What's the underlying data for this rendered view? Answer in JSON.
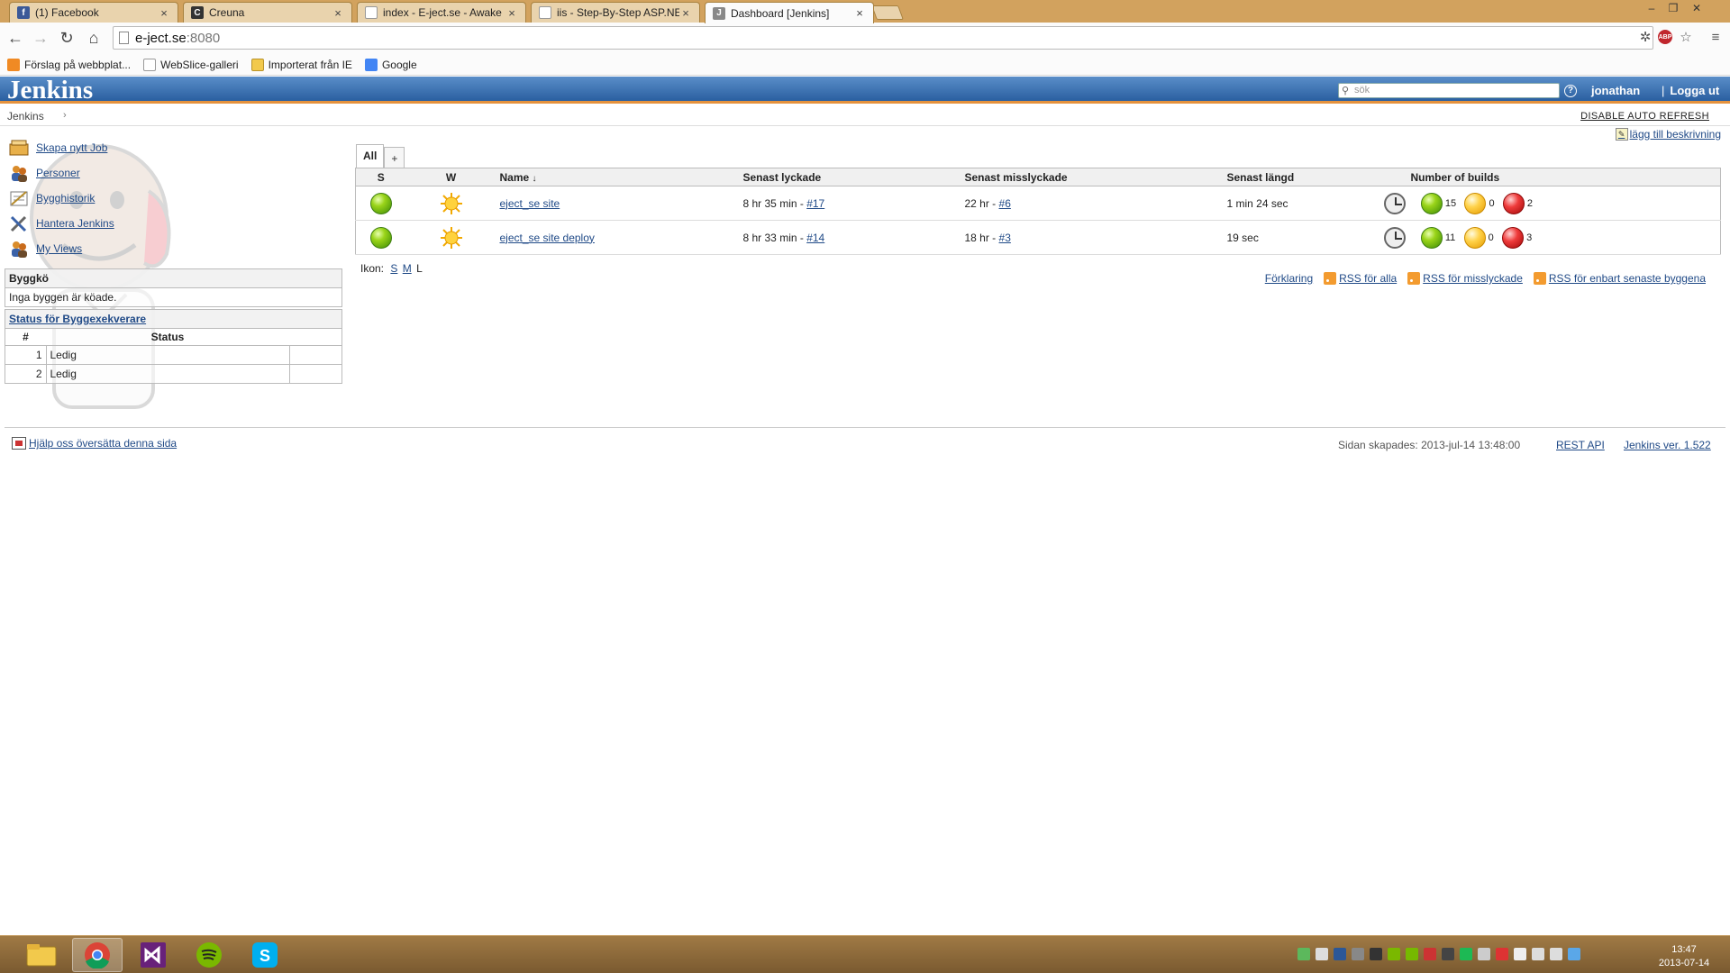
{
  "browser": {
    "tabs": [
      {
        "title": "(1) Facebook",
        "favicon_color": "#3b5998",
        "favicon_glyph": "f"
      },
      {
        "title": "Creuna",
        "favicon_color": "#333333",
        "favicon_glyph": "C"
      },
      {
        "title": "index - E-ject.se - Awake ...",
        "favicon_color": "#dddddd",
        "favicon_glyph": ""
      },
      {
        "title": "iis - Step-By-Step ASP.NET ...",
        "favicon_color": "#dddddd",
        "favicon_glyph": ""
      },
      {
        "title": "Dashboard [Jenkins]",
        "favicon_color": "#888888",
        "favicon_glyph": "J"
      }
    ],
    "address": {
      "host": "e-ject.se",
      "port": ":8080"
    },
    "bookmarks": [
      {
        "label": "Förslag på webbplat...",
        "icon_color": "#f08a24"
      },
      {
        "label": "WebSlice-galleri",
        "icon_color": "#ffffff"
      },
      {
        "label": "Importerat från IE",
        "icon_color": "#f2c94c"
      },
      {
        "label": "Google",
        "icon_color": "#4285f4"
      }
    ]
  },
  "jenkins": {
    "logo": "Jenkins",
    "search_placeholder": "sök",
    "user": "jonathan",
    "logout": "Logga ut",
    "breadcrumb": "Jenkins",
    "disable_auto_refresh": "DISABLE AUTO REFRESH",
    "add_description": "lägg till beskrivning",
    "tasks": [
      {
        "label": "Skapa nytt Job",
        "icon": "new-job-icon"
      },
      {
        "label": "Personer",
        "icon": "people-icon"
      },
      {
        "label": "Bygghistorik",
        "icon": "build-history-icon"
      },
      {
        "label": "Hantera Jenkins",
        "icon": "manage-jenkins-icon"
      },
      {
        "label": "My Views",
        "icon": "my-views-icon"
      }
    ],
    "queue": {
      "title": "Byggkö",
      "empty": "Inga byggen är köade."
    },
    "executors": {
      "title": "Status för Byggexekverare",
      "col_num": "#",
      "col_status": "Status",
      "rows": [
        {
          "num": "1",
          "status": "Ledig"
        },
        {
          "num": "2",
          "status": "Ledig"
        }
      ]
    },
    "view_tabs": {
      "active": "All",
      "add": "+"
    },
    "columns": {
      "s": "S",
      "w": "W",
      "name": "Name",
      "sort_arrow": "↓",
      "last_success": "Senast lyckade",
      "last_failure": "Senast misslyckade",
      "last_duration": "Senast längd",
      "builds": "Number of builds"
    },
    "jobs": [
      {
        "name": "eject_se site",
        "status": "blue",
        "weather": "sunny",
        "last_success": "8 hr 35 min - ",
        "last_success_build": "#17",
        "last_failure": "22 hr - ",
        "last_failure_build": "#6",
        "duration": "1 min 24 sec",
        "success_count": "15",
        "unstable_count": "0",
        "failed_count": "2"
      },
      {
        "name": "eject_se site deploy",
        "status": "blue",
        "weather": "sunny",
        "last_success": "8 hr 33 min - ",
        "last_success_build": "#14",
        "last_failure": "18 hr - ",
        "last_failure_build": "#3",
        "duration": "19 sec",
        "success_count": "11",
        "unstable_count": "0",
        "failed_count": "3"
      }
    ],
    "icon_size": {
      "label": "Ikon:",
      "s": "S",
      "m": "M",
      "l": "L"
    },
    "rss": {
      "legend": "Förklaring",
      "all": "RSS för alla",
      "failed": "RSS för misslyckade",
      "latest": "RSS för enbart senaste byggena"
    },
    "footer": {
      "translate": "Hjälp oss översätta denna sida",
      "generated": "Sidan skapades: 2013-jul-14 13:48:00",
      "rest_api": "REST API",
      "version": "Jenkins ver. 1.522"
    }
  },
  "taskbar": {
    "time": "13:47",
    "date": "2013-07-14"
  }
}
